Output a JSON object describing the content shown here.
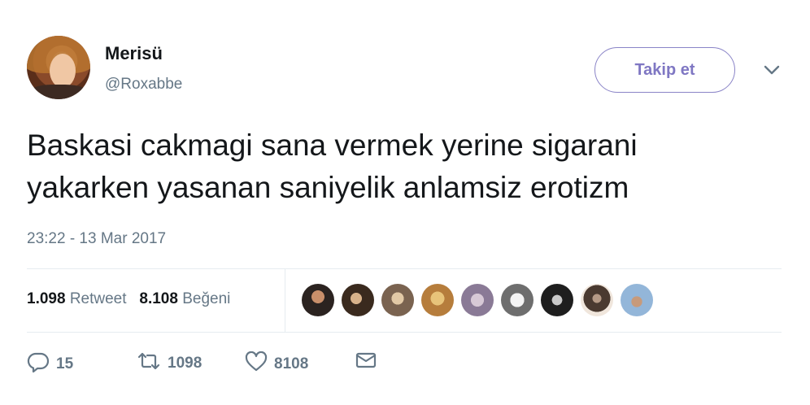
{
  "user": {
    "name": "Merisü",
    "handle": "@Roxabbe"
  },
  "follow_button": {
    "label": "Takip et"
  },
  "tweet": {
    "lines": [
      "Baskasi cakmagi sana vermek yerine sigarani",
      "yakarken yasanan saniyelik anlamsiz erotizm"
    ],
    "timestamp": "23:22 - 13 Mar 2017"
  },
  "stats": {
    "retweets": {
      "count": "1.098",
      "label": "Retweet"
    },
    "likes": {
      "count": "8.108",
      "label": "Beğeni"
    }
  },
  "likers": [
    "liker-1",
    "liker-2",
    "liker-3",
    "liker-4",
    "liker-5",
    "liker-6",
    "liker-7",
    "liker-8",
    "liker-9"
  ],
  "actions": {
    "reply": "15",
    "retweet": "1098",
    "like": "8108"
  },
  "icons": [
    "chevron-down-icon",
    "reply-icon",
    "retweet-icon",
    "heart-icon",
    "envelope-icon"
  ],
  "colors": {
    "follow_accent": "#7f77c3",
    "secondary_text": "#657786",
    "divider": "#e6ecf0"
  }
}
